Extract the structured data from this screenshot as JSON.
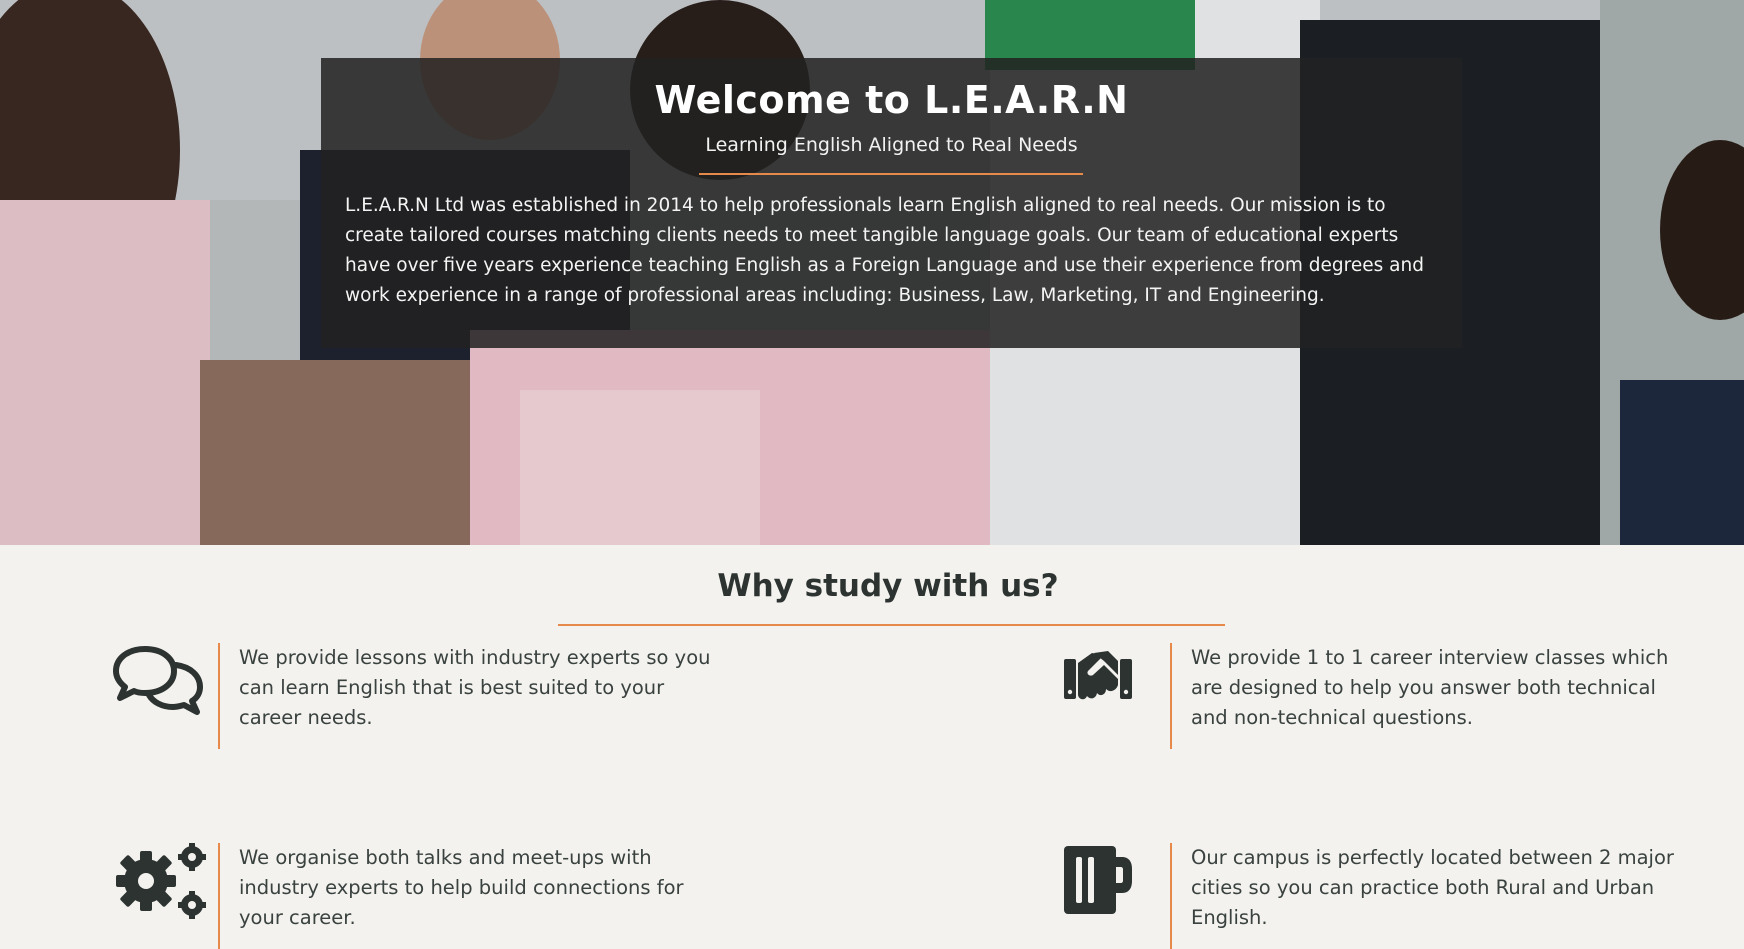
{
  "hero": {
    "title": "Welcome to L.E.A.R.N",
    "subtitle": "Learning English Aligned to Real Needs",
    "body": "L.E.A.R.N Ltd was established in 2014 to help professionals learn English aligned to real needs. Our mission is to create tailored courses matching clients needs to meet tangible language goals. Our team of educational experts have over five years experience teaching English as a Foreign Language and use their experience from degrees and work experience in a range of professional areas including: Business, Law, Marketing, IT and Engineering."
  },
  "why": {
    "title": "Why study with us?",
    "features": [
      {
        "icon": "chat-bubbles-icon",
        "text": "We provide lessons with industry experts so you can learn English that is best suited to your career needs."
      },
      {
        "icon": "handshake-icon",
        "text": "We provide 1 to 1 career interview classes which are designed to help you answer both technical and non-technical questions."
      },
      {
        "icon": "gears-icon",
        "text": "We organise both talks and meet-ups with industry experts to help build connections for your career."
      },
      {
        "icon": "beer-mug-icon",
        "text": "Our campus is perfectly located between 2 major cities so you can practice both Rural and Urban English."
      }
    ]
  },
  "colors": {
    "accent": "#e58a4a",
    "text": "#2c3331",
    "background": "#f3f2ee",
    "panel": "#222222"
  }
}
